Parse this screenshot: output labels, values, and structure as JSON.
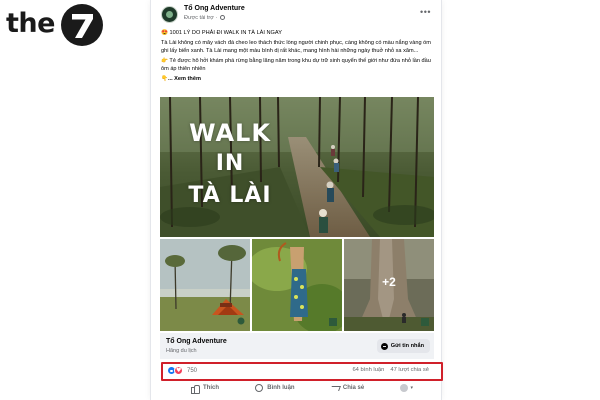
{
  "brand": {
    "logo_text": "the",
    "logo_numeral": "7"
  },
  "post": {
    "page_name": "Tổ Ong Adventure",
    "meta": "Được tài trợ ·",
    "more_icon": "•••",
    "text": {
      "line1": "😍 1001 LÝ DO PHẢI ĐI WALK IN TÀ LÀI NGAY",
      "line2": "Tà Lài không có mây vách đá cheo leo thách thức lòng người chinh phục, càng không có màu nắng vàng óm ghi lấy biển xanh. Tà Lài mang một màu bình dị rất khác, mang hình hài những ngày thuở nhỏ xa xăm...",
      "line3": "👉 Tẻ được hô hởi khám phá rừng bằng lăng năm trong khu dự trữ sinh quyển thế giới như đứa nhỏ lần đầu ôm áp thiên nhiên",
      "see_more": "👇... Xem thêm"
    },
    "photo": {
      "title_line1": "WALK",
      "title_line2": "IN",
      "title_line3": "TÀ LÀI",
      "more_count": "+2"
    },
    "page_info": {
      "name": "Tổ Ong Adventure",
      "category": "Hãng du lịch",
      "message_button": "Gửi tin nhắn"
    },
    "stats": {
      "reaction_count": "750",
      "comments": "64 bình luận",
      "shares": "47 lượt chia sẻ"
    },
    "actions": {
      "like": "Thích",
      "comment": "Bình luận",
      "share": "Chia sẻ",
      "caret": "▾"
    }
  },
  "colors": {
    "highlight": "#d0202a",
    "like_blue": "#1877f2",
    "love_red": "#f33e58"
  }
}
